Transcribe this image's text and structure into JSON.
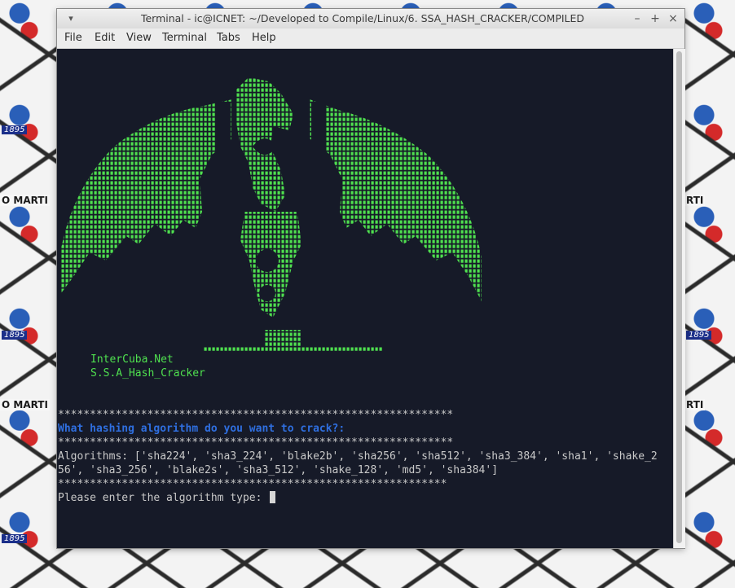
{
  "window": {
    "title": "Terminal - ic@ICNET: ~/Developed to Compile/Linux/6. SSA_HASH_CRACKER/COMPILED",
    "menu_arrow": "▾",
    "minimize": "–",
    "maximize": "+",
    "close": "×"
  },
  "menubar": [
    "File",
    "Edit",
    "View",
    "Terminal",
    "Tabs",
    "Help"
  ],
  "wallpaper": {
    "labels": [
      "O MARTI",
      "RTI",
      "O MARTI",
      "RTI"
    ],
    "years": [
      "1895",
      "1895",
      "1895",
      "1895"
    ]
  },
  "terminal": {
    "brand_line1": "InterCuba.Net",
    "brand_line2": "S.S.A_Hash_Cracker",
    "stars1": "**************************************************************",
    "question": "What hashing algorithm do you want to crack?:",
    "stars2": "**************************************************************",
    "algorithms_line1": "Algorithms: ['sha224', 'sha3_224', 'blake2b', 'sha256', 'sha512', 'sha3_384', 'sha1', 'shake_2",
    "algorithms_line2": "56', 'sha3_256', 'blake2s', 'sha3_512', 'shake_128', 'md5', 'sha384']",
    "stars3": "*************************************************************",
    "prompt": "Please enter the algorithm type: "
  },
  "colors": {
    "terminal_bg": "#161a28",
    "art_green": "#4fe04f",
    "question_blue": "#2f6fe0",
    "text_grey": "#c9c9c9"
  }
}
